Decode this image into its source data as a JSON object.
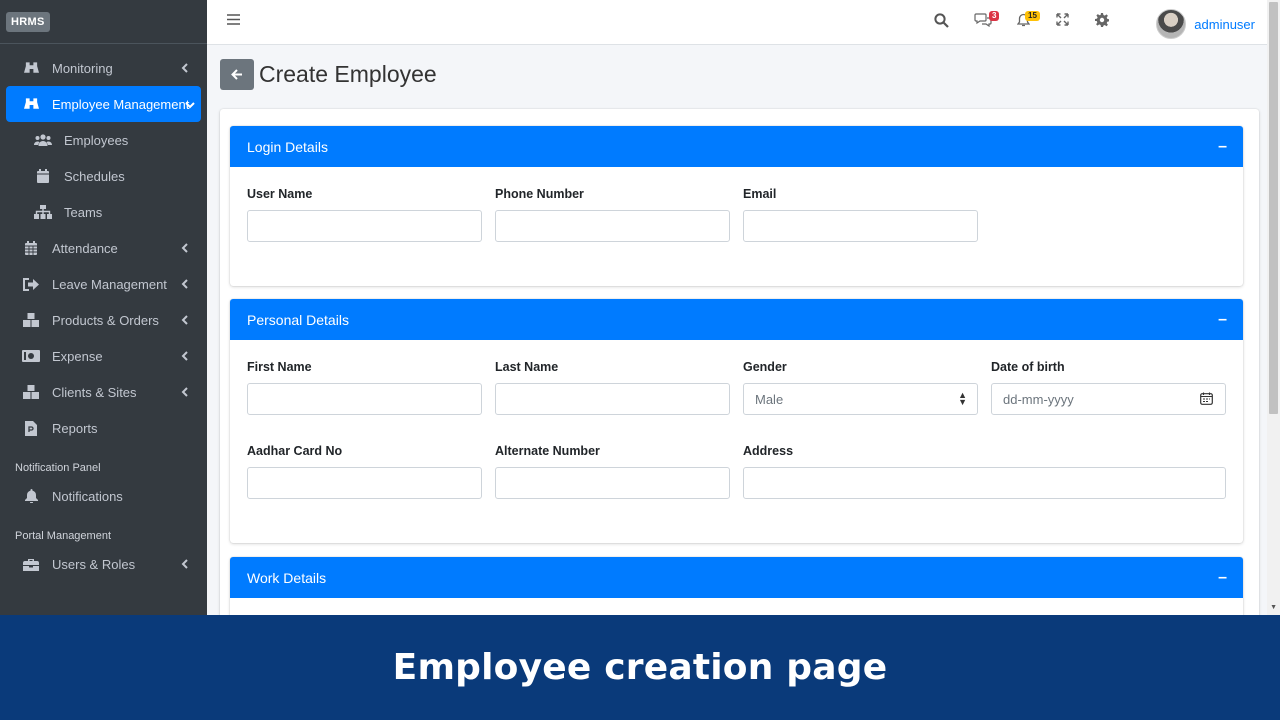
{
  "brand": "HRMS",
  "sidebar": {
    "items": [
      {
        "label": "Monitoring",
        "icon": "binoculars-icon"
      },
      {
        "label": "Employee Management",
        "icon": "binoculars-icon"
      },
      {
        "label": "Employees",
        "icon": "users-icon"
      },
      {
        "label": "Schedules",
        "icon": "calendar-icon"
      },
      {
        "label": "Teams",
        "icon": "sitemap-icon"
      },
      {
        "label": "Attendance",
        "icon": "calendar-grid-icon"
      },
      {
        "label": "Leave Management",
        "icon": "sign-out-icon"
      },
      {
        "label": "Products & Orders",
        "icon": "boxes-icon"
      },
      {
        "label": "Expense",
        "icon": "money-bill-icon"
      },
      {
        "label": "Clients & Sites",
        "icon": "boxes-icon"
      },
      {
        "label": "Reports",
        "icon": "file-icon"
      },
      {
        "label": "Notifications",
        "icon": "bell-icon"
      },
      {
        "label": "Users & Roles",
        "icon": "toolbox-icon"
      }
    ],
    "headers": {
      "notification_panel": "Notification Panel",
      "portal_management": "Portal Management"
    }
  },
  "topbar": {
    "messages_count": "3",
    "notifications_count": "15",
    "user_name": "adminuser"
  },
  "page": {
    "title": "Create Employee"
  },
  "sections": {
    "login": {
      "title": "Login Details",
      "user_name": "User Name",
      "phone_number": "Phone Number",
      "email": "Email"
    },
    "personal": {
      "title": "Personal Details",
      "first_name": "First Name",
      "last_name": "Last Name",
      "gender": "Gender",
      "gender_value": "Male",
      "dob": "Date of birth",
      "dob_placeholder": "dd-mm-yyyy",
      "aadhar": "Aadhar Card No",
      "alternate_number": "Alternate Number",
      "address": "Address"
    },
    "work": {
      "title": "Work Details"
    }
  },
  "banner": {
    "text": "Employee creation page"
  },
  "colors": {
    "primary": "#007bff",
    "sidebar": "#343a40",
    "banner": "#0a3a7a"
  }
}
